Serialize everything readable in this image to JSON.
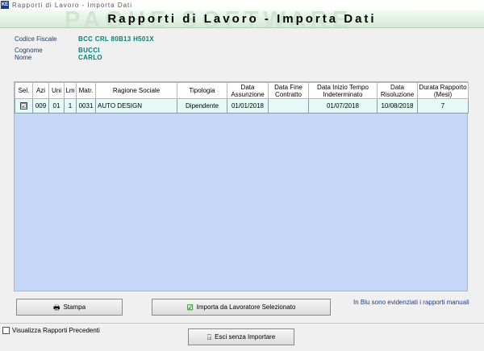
{
  "window": {
    "title": "Rapporti di Lavoro - Importa Dati",
    "app_icon_text": "KE"
  },
  "header": {
    "title": "Rapporti di Lavoro - Importa Dati",
    "watermark": "PAGHE SOFTWARE"
  },
  "info": {
    "codice_fiscale_label": "Codice Fiscale",
    "codice_fiscale_value": "BCC CRL 80B13 H501X",
    "cognome_label": "Cognome",
    "cognome_value": "BUCCI",
    "nome_label": "Nome",
    "nome_value": "CARLO"
  },
  "table": {
    "columns": [
      "Sel.",
      "Azi",
      "Uni",
      "Lm",
      "Matr.",
      "Ragione Sociale",
      "Tipologia",
      "Data Assunzione",
      "Data Fine Contratto",
      "Data Inizio Tempo Indeterminato",
      "Data Risoluzione",
      "Durata Rapporto (Mesi)"
    ],
    "rows": [
      {
        "sel": "☑",
        "azi": "009",
        "uni": "01",
        "lm": "1",
        "matr": "0031",
        "ragione_sociale": "AUTO DESIGN",
        "tipologia": "Dipendente",
        "data_assunzione": "01/01/2018",
        "data_fine_contratto": "",
        "data_inizio_tempo_indeterminato": "01/07/2018",
        "data_risoluzione": "10/08/2018",
        "durata_rapporto": "7"
      }
    ]
  },
  "buttons": {
    "stampa": "Stampa",
    "importa": "Importa da Lavoratore Selezionato",
    "esci": "Esci senza Importare"
  },
  "legend": "In Blu sono evidenziati i rapporti manuali",
  "visualizza_checkbox": "Visualizza Rapporti Precedenti",
  "colors": {
    "header_bg": "#e3f1e4",
    "grid_bg": "#c6d6f6",
    "row_bg": "#e5faf7",
    "value_text": "#00807a",
    "legend_text": "#1b3f8b"
  }
}
